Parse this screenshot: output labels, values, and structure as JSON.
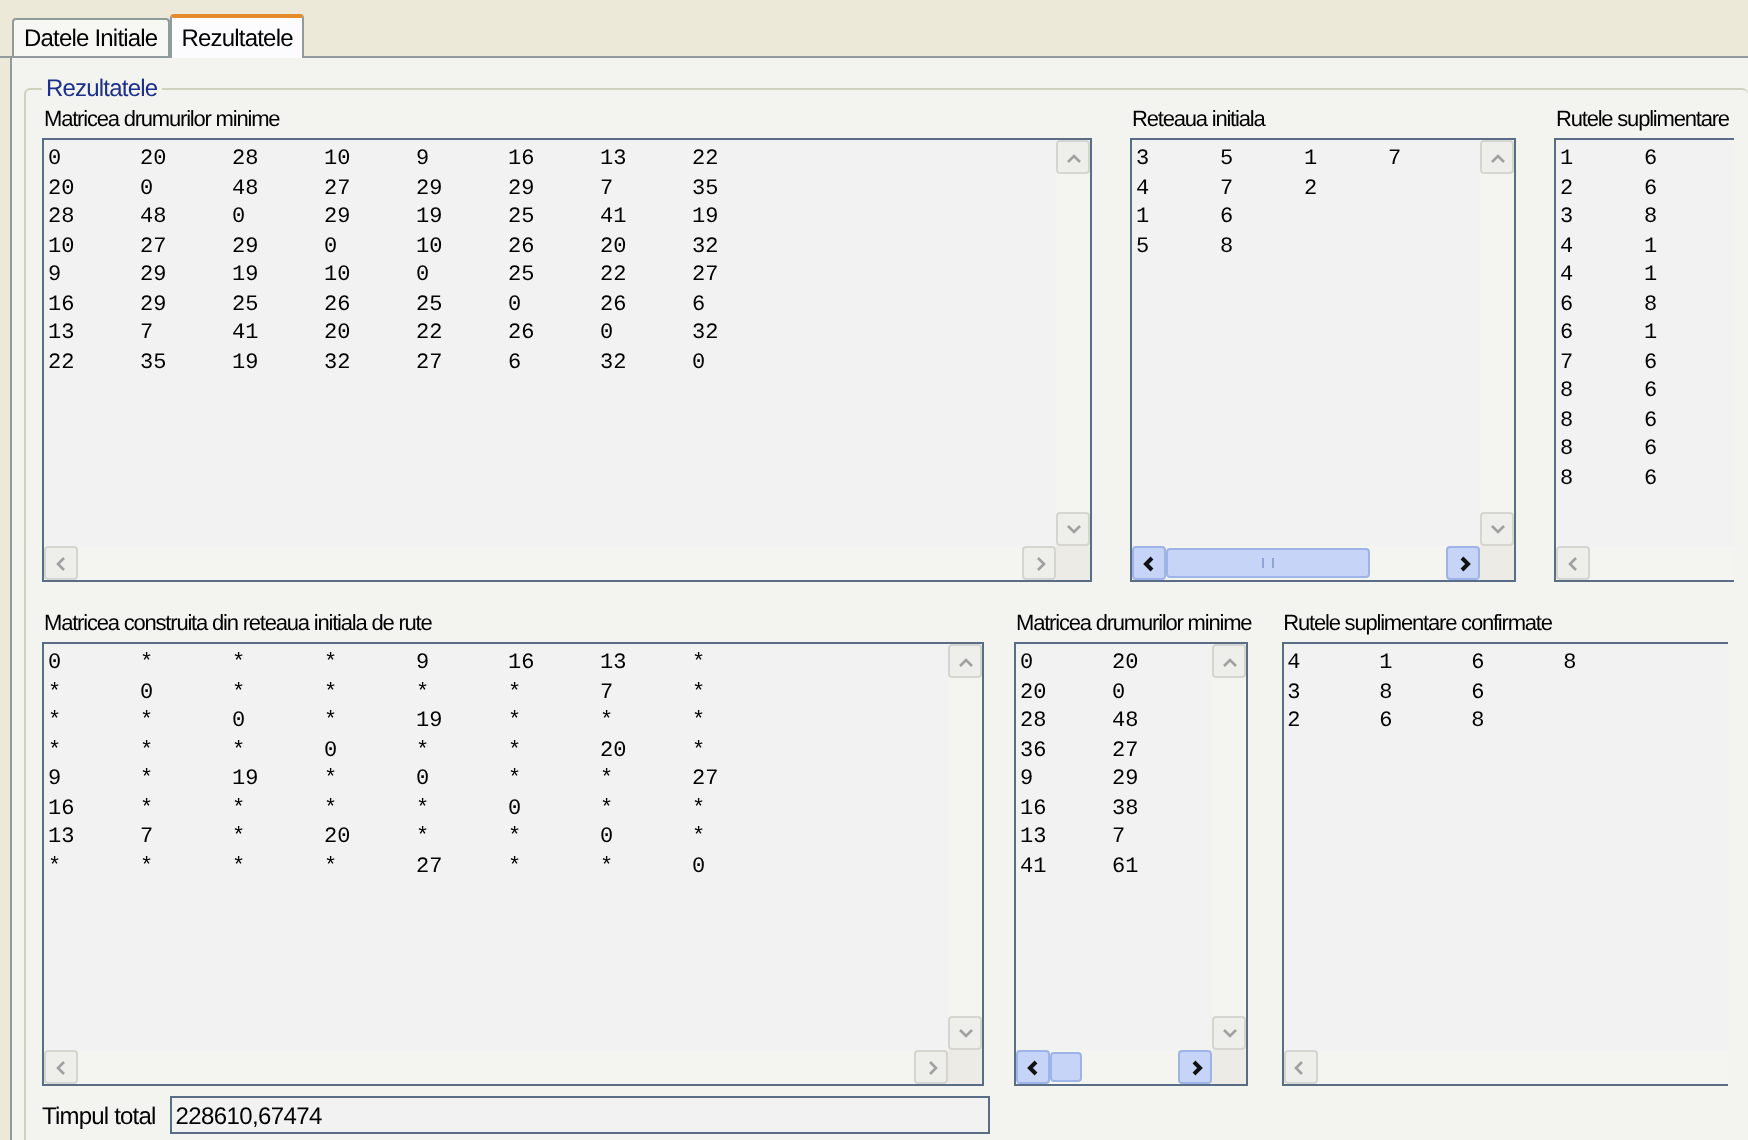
{
  "tabs": [
    {
      "label": "Datele Initiale",
      "selected": false
    },
    {
      "label": "Rezultatele",
      "selected": true
    }
  ],
  "group": {
    "title": "Rezultatele"
  },
  "lists": [
    {
      "label": "Matricea drumurilor minime",
      "rows": [
        [
          "0",
          "20",
          "28",
          "10",
          "9",
          "16",
          "13",
          "22"
        ],
        [
          "20",
          "0",
          "48",
          "27",
          "29",
          "29",
          "7",
          "35"
        ],
        [
          "28",
          "48",
          "0",
          "29",
          "19",
          "25",
          "41",
          "19"
        ],
        [
          "10",
          "27",
          "29",
          "0",
          "10",
          "26",
          "20",
          "32"
        ],
        [
          "9",
          "29",
          "19",
          "10",
          "0",
          "25",
          "22",
          "27"
        ],
        [
          "16",
          "29",
          "25",
          "26",
          "25",
          "0",
          "26",
          "6"
        ],
        [
          "13",
          "7",
          "41",
          "20",
          "22",
          "26",
          "0",
          "32"
        ],
        [
          "22",
          "35",
          "19",
          "32",
          "27",
          "6",
          "32",
          "0"
        ]
      ]
    },
    {
      "label": "Reteaua initiala",
      "rows": [
        [
          "3",
          "5",
          "1",
          "7"
        ],
        [
          "4",
          "7",
          "2"
        ],
        [
          "1",
          "6"
        ],
        [
          "5",
          "8"
        ]
      ]
    },
    {
      "label": "Rutele suplimentare",
      "rows": [
        [
          "1",
          "6"
        ],
        [
          "2",
          "6"
        ],
        [
          "3",
          "8"
        ],
        [
          "4",
          "1"
        ],
        [
          "4",
          "1"
        ],
        [
          "6",
          "8"
        ],
        [
          "6",
          "1"
        ],
        [
          "7",
          "6"
        ],
        [
          "8",
          "6"
        ],
        [
          "8",
          "6"
        ],
        [
          "8",
          "6"
        ],
        [
          "8",
          "6"
        ]
      ]
    },
    {
      "label": "Matricea construita din reteaua initiala de rute",
      "rows": [
        [
          "0",
          "*",
          "*",
          "*",
          "9",
          "16",
          "13",
          "*"
        ],
        [
          "*",
          "0",
          "*",
          "*",
          "*",
          "*",
          "7",
          "*"
        ],
        [
          "*",
          "*",
          "0",
          "*",
          "19",
          "*",
          "*",
          "*"
        ],
        [
          "*",
          "*",
          "*",
          "0",
          "*",
          "*",
          "20",
          "*"
        ],
        [
          "9",
          "*",
          "19",
          "*",
          "0",
          "*",
          "*",
          "27"
        ],
        [
          "16",
          "*",
          "*",
          "*",
          "*",
          "0",
          "*",
          "*"
        ],
        [
          "13",
          "7",
          "*",
          "20",
          "*",
          "*",
          "0",
          "*"
        ],
        [
          "*",
          "*",
          "*",
          "*",
          "27",
          "*",
          "*",
          "0"
        ]
      ]
    },
    {
      "label": "Matricea drumurilor minime",
      "rows": [
        [
          "0",
          "20"
        ],
        [
          "20",
          "0"
        ],
        [
          "28",
          "48"
        ],
        [
          "36",
          "27"
        ],
        [
          "9",
          "29"
        ],
        [
          "16",
          "38"
        ],
        [
          "13",
          "7"
        ],
        [
          "41",
          "61"
        ]
      ]
    },
    {
      "label": "Rutele suplimentare confirmate",
      "rows": [
        [
          "4",
          "1",
          "6",
          "8"
        ],
        [
          "3",
          "8",
          "6"
        ],
        [
          "2",
          "6",
          "8"
        ]
      ]
    }
  ],
  "total_time": {
    "label": "Timpul total",
    "value": "228610,67474"
  }
}
